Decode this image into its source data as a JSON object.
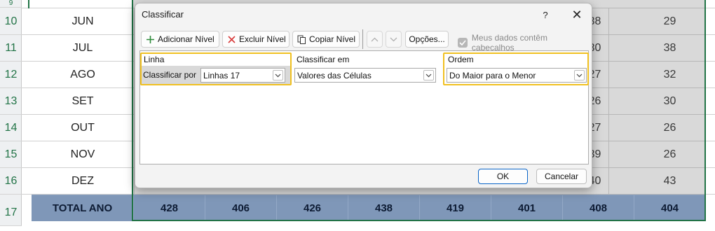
{
  "sheet": {
    "row_numbers": [
      "9",
      "10",
      "11",
      "12",
      "13",
      "14",
      "15",
      "16",
      "17"
    ],
    "months": [
      "JUN",
      "JUL",
      "AGO",
      "SET",
      "OUT",
      "NOV",
      "DEZ"
    ],
    "right_col_a": [
      "38",
      "30",
      "27",
      "26",
      "27",
      "39",
      "40"
    ],
    "right_col_b": [
      "29",
      "38",
      "32",
      "30",
      "26",
      "26",
      "43"
    ],
    "total": {
      "label": "TOTAL ANO",
      "values": [
        "428",
        "406",
        "426",
        "438",
        "419",
        "401",
        "408",
        "404"
      ]
    }
  },
  "dialog": {
    "title": "Classificar",
    "help": "?",
    "close": "✕",
    "toolbar": {
      "add_level": "Adicionar Nível",
      "delete_level": "Excluir Nível",
      "copy_level": "Copiar Nível",
      "options": "Opções...",
      "headers_checkbox_label": "Meus dados contêm cabeçalhos"
    },
    "columns": {
      "linha": "Linha",
      "classificar_em": "Classificar em",
      "ordem": "Ordem"
    },
    "level": {
      "label": "Classificar por",
      "row_value": "Linhas 17",
      "sort_on_value": "Valores das Células",
      "order_value": "Do Maior para o Menor"
    },
    "ok": "OK",
    "cancel": "Cancelar"
  },
  "colors": {
    "highlight": "#f0c020",
    "excel_green": "#217346",
    "total_row_bg": "#7f97b8",
    "ok_border": "#0a64c8"
  }
}
